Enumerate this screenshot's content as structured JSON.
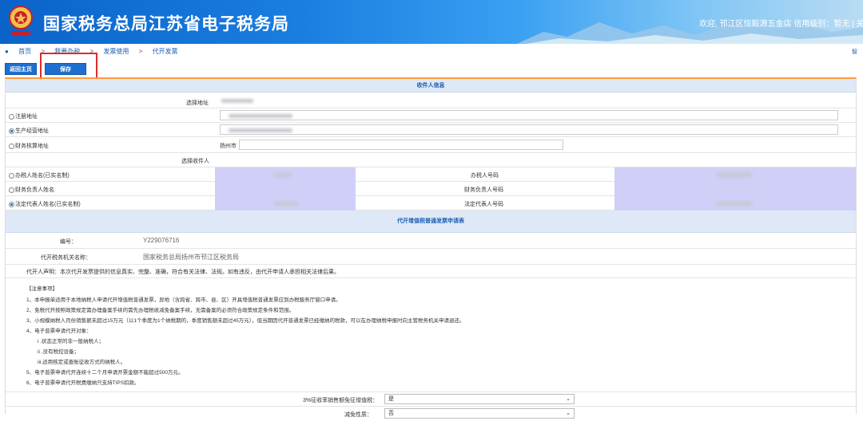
{
  "header": {
    "title": "国家税务总局江苏省电子税务局",
    "welcome": "欢迎, 邗江区恒毅源五金店  信用级别：暂无  |  关闭"
  },
  "breadcrumb": {
    "items": [
      "首页",
      "我要办税",
      "发票使用",
      "代开发票"
    ],
    "sep": ">"
  },
  "toolbar": {
    "back_label": "返回主页",
    "save_label": "保存"
  },
  "right_side": {
    "label": "智"
  },
  "sections": {
    "recipient": "收件人信息",
    "application": "代开增值税普通发票申请表"
  },
  "address": {
    "select_label": "选择地址",
    "options": [
      {
        "label": "注册地址",
        "checked": false
      },
      {
        "label": "生产经营地址",
        "checked": true
      },
      {
        "label": "财务核算地址",
        "checked": false
      }
    ],
    "city_prefix": "扬州市"
  },
  "recipient": {
    "select_label": "选择收件人",
    "options": [
      {
        "label": "办税人姓名(已实名制)",
        "checked": false,
        "right_label": "办税人号码"
      },
      {
        "label": "财务负责人姓名",
        "checked": false,
        "right_label": "财务负责人号码"
      },
      {
        "label": "法定代表人姓名(已实名制)",
        "checked": true,
        "right_label": "法定代表人号码"
      }
    ]
  },
  "application": {
    "number_label": "编号：",
    "number_value": "Y229076716",
    "office_label": "代开税务机关名称：",
    "office_value": "国家税务总局扬州市邗江区税务局",
    "declaration": "代开人声明：本次代开发票提供的信息真实、完整、准确，符合有关法律、法规。如有违反，由代开申请人承担相关法律后果。"
  },
  "notes": {
    "title": "【注意事项】",
    "items": [
      "1、本申报单适用于本地纳税人申请代开增值税普通发票，异地（含跨省、跨市、县、区）开具增值税普通发票应到办税服务厅窗口申请。",
      "2、免税代开按照政策规定需办理备案手续的需先办理税收减免备案手续，无需备案的必须符合政策规定条件和范围。",
      "3、小规模纳税人月份销售额未超过15万元（以1个季度为1个纳税期的，季度销售额未超过45万元），但当期因代开普通发票已经缴纳的税款，可以在办理纳税申报时向主管税务机关申请退还。",
      "4、电子普票申请代开对象：",
      "i .状态正常的非一般纳税人；",
      "ii .没有税控设备；",
      "iii.适用核定或查账征收方式的纳税人。",
      "5、电子普票申请代开连续十二个月申请开票金额不能超过500万元。",
      "6、电子普票申请代开税费缴纳只支持TIPS扣款。"
    ]
  },
  "bottom": {
    "field1_label": "3%征收率销售额免征增值税：",
    "field1_value": "是",
    "field2_label": "减免性质：",
    "field2_value": "否"
  },
  "colors": {
    "accent": "#1d6fcf",
    "section_bg": "#dfe8f6",
    "purple_cell": "#cfcff7",
    "highlight": "#e02a2a",
    "top_border": "#ff9a3c"
  }
}
